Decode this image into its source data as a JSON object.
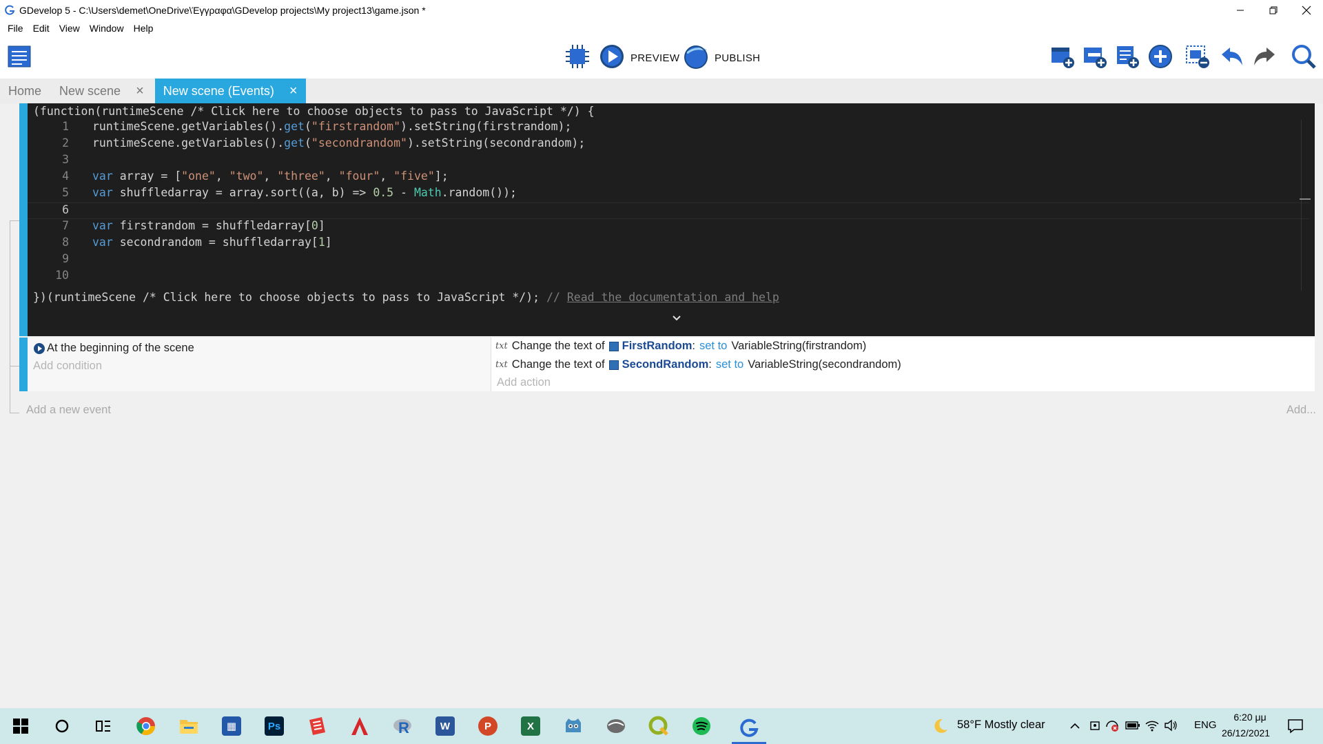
{
  "window": {
    "title": "GDevelop 5 - C:\\Users\\demet\\OneDrive\\Έγγραφα\\GDevelop projects\\My project13\\game.json *",
    "minimize_label": "–",
    "restore_label": "❐",
    "close_label": "✕"
  },
  "menu": {
    "items": [
      "File",
      "Edit",
      "View",
      "Window",
      "Help"
    ]
  },
  "toolbar": {
    "preview_label": "PREVIEW",
    "publish_label": "PUBLISH"
  },
  "tabs": [
    {
      "label": "Home",
      "closable": false,
      "active": false
    },
    {
      "label": "New scene",
      "closable": true,
      "active": false
    },
    {
      "label": "New scene (Events)",
      "closable": true,
      "active": true
    }
  ],
  "tab_close_glyph": "×",
  "editor": {
    "header": "(function(runtimeScene /* Click here to choose objects to pass to JavaScript */) {",
    "footer_code": "})(runtimeScene /* Click here to choose objects to pass to JavaScript */); ",
    "footer_comment": "// ",
    "footer_link": "Read the documentation and help",
    "line_numbers": [
      "1",
      "2",
      "3",
      "4",
      "5",
      "6",
      "7",
      "8",
      "9",
      "10"
    ],
    "current_line": 6
  },
  "event": {
    "condition": "At the beginning of the scene",
    "add_condition": "Add condition",
    "actions": [
      {
        "prefix": "Change the text of",
        "object": "FirstRandom",
        "op": "set to",
        "value": "VariableString(firstrandom)"
      },
      {
        "prefix": "Change the text of",
        "object": "SecondRandom",
        "op": "set to",
        "value": "VariableString(secondrandom)"
      }
    ],
    "action_icon_text": "txt",
    "object_separator": ":",
    "add_action": "Add action"
  },
  "add_new_event": "Add a new event",
  "add_more": "Add...",
  "taskbar": {
    "weather": "58°F  Mostly clear",
    "language": "ENG",
    "time": "6:20 μμ",
    "date": "26/12/2021",
    "apps": [
      "start",
      "search",
      "task-view",
      "chrome",
      "file-explorer",
      "store",
      "photoshop",
      "app-red",
      "acrobat",
      "r",
      "word",
      "powerpoint",
      "excel",
      "godot",
      "app-gray",
      "qgis",
      "spotify",
      "gdevelop"
    ]
  },
  "colors": {
    "accent": "#29a8e0",
    "editor_bg": "#1e1e1e",
    "keyword": "#569cd6",
    "string": "#ce9178",
    "number": "#b5cea8",
    "class": "#4ec9b0",
    "object_name": "#1b4a94",
    "operator": "#2a8fd9",
    "taskbar": "#cfe8ea"
  }
}
